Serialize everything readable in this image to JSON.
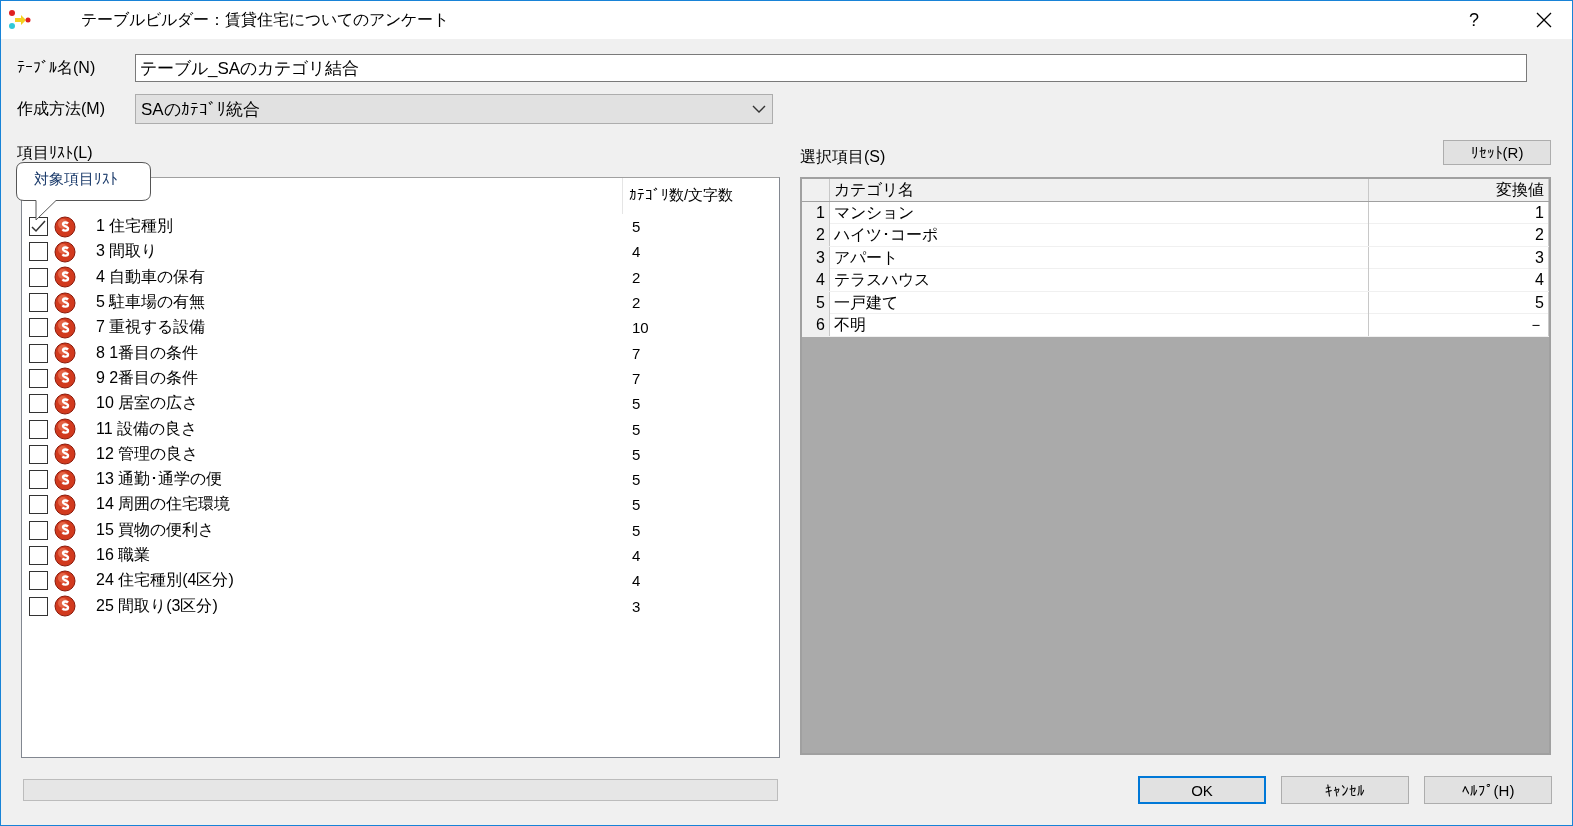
{
  "window": {
    "title": "テーブルビルダー：賃貸住宅についてのアンケート",
    "help": "?"
  },
  "table_name": {
    "label": "ﾃｰﾌﾞﾙ名(N)",
    "value": "テーブル_SAのカテゴリ結合"
  },
  "method": {
    "label": "作成方法(M)",
    "value": "SAのｶﾃｺﾞﾘ統合"
  },
  "item_list": {
    "label": "項目ﾘｽﾄ(L)",
    "tooltip": "対象項目ﾘｽﾄ",
    "count_header": "ｶﾃｺﾞﾘ数/文字数",
    "items": [
      {
        "label": "1 住宅種別",
        "count": "5",
        "checked": true
      },
      {
        "label": "3 間取り",
        "count": "4",
        "checked": false
      },
      {
        "label": "4 自動車の保有",
        "count": "2",
        "checked": false
      },
      {
        "label": "5 駐車場の有無",
        "count": "2",
        "checked": false
      },
      {
        "label": "7 重視する設備",
        "count": "10",
        "checked": false
      },
      {
        "label": "8 1番目の条件",
        "count": "7",
        "checked": false
      },
      {
        "label": "9 2番目の条件",
        "count": "7",
        "checked": false
      },
      {
        "label": "10 居室の広さ",
        "count": "5",
        "checked": false
      },
      {
        "label": "11 設備の良さ",
        "count": "5",
        "checked": false
      },
      {
        "label": "12 管理の良さ",
        "count": "5",
        "checked": false
      },
      {
        "label": "13 通勤･通学の便",
        "count": "5",
        "checked": false
      },
      {
        "label": "14 周囲の住宅環境",
        "count": "5",
        "checked": false
      },
      {
        "label": "15 買物の便利さ",
        "count": "5",
        "checked": false
      },
      {
        "label": "16 職業",
        "count": "4",
        "checked": false
      },
      {
        "label": "24 住宅種別(4区分)",
        "count": "4",
        "checked": false
      },
      {
        "label": "25 間取り(3区分)",
        "count": "3",
        "checked": false
      }
    ]
  },
  "selected_items": {
    "label": "選択項目(S)",
    "reset_button": "ﾘｾｯﾄ(R)",
    "columns": [
      "カテゴリ名",
      "変換値"
    ],
    "rows": [
      {
        "index": "1",
        "name": "マンション",
        "value": "1"
      },
      {
        "index": "2",
        "name": "ハイツ･コーポ",
        "value": "2"
      },
      {
        "index": "3",
        "name": "アパート",
        "value": "3"
      },
      {
        "index": "4",
        "name": "テラスハウス",
        "value": "4"
      },
      {
        "index": "5",
        "name": "一戸建て",
        "value": "5"
      },
      {
        "index": "6",
        "name": "不明",
        "value": "－"
      }
    ]
  },
  "progress": {
    "level": 0
  },
  "buttons": [
    {
      "label": "OK",
      "default": true
    },
    {
      "label": "ｷｬﾝｾﾙ",
      "default": false
    },
    {
      "label": "ﾍﾙﾌﾟ(H)",
      "default": false
    }
  ]
}
